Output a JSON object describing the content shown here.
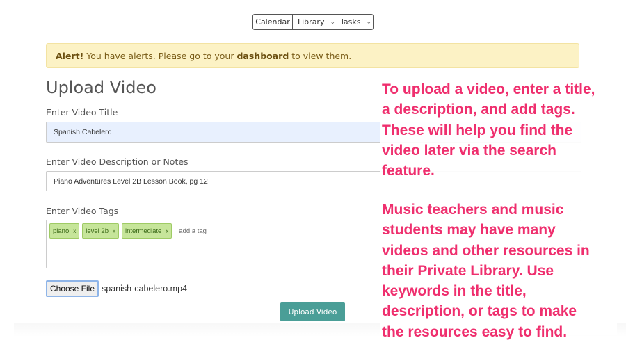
{
  "nav": {
    "calendar": "Calendar",
    "library": "Library",
    "tasks": "Tasks"
  },
  "alert": {
    "bold_prefix": "Alert!",
    "text_before_link": "You have alerts. Please go to your",
    "link": "dashboard",
    "text_after_link": "to view them."
  },
  "page_title": "Upload Video",
  "form": {
    "title_label": "Enter Video Title",
    "title_value": "Spanish Cabelero",
    "description_label": "Enter Video Description or Notes",
    "description_value": "Piano Adventures Level 2B Lesson Book, pg 12",
    "tags_label": "Enter Video Tags",
    "tags": [
      {
        "label": "piano",
        "remove": "x"
      },
      {
        "label": "level 2b",
        "remove": "x"
      },
      {
        "label": "intermediate",
        "remove": "x"
      }
    ],
    "tag_placeholder": "add a tag",
    "choose_file_label": "Choose File",
    "file_name": "spanish-cabelero.mp4",
    "upload_button": "Upload Video"
  },
  "annotation": {
    "paragraph1": "To upload a video, enter a title,\na description, and add tags.\nThese will help you find the\nvideo later via the search\nfeature.",
    "paragraph2": "Music teachers and music\nstudents may have many\nvideos and other resources in\ntheir Private Library. Use\nkeywords in the title,\ndescription, or tags to make\nthe resources easy to find.",
    "color": "#ef2f6e"
  },
  "colors": {
    "accent_button": "#4a9e97",
    "alert_background": "#fcf2c5",
    "tag_background": "#c6e59a",
    "autofill_background": "#e8f0fe"
  }
}
